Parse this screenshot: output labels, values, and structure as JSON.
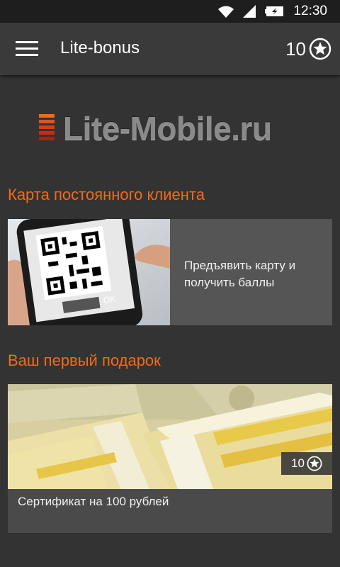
{
  "status_bar": {
    "time": "12:30"
  },
  "app_bar": {
    "title": "Lite-bonus",
    "points": "10"
  },
  "logo": {
    "text": "Lite-Mobile.ru"
  },
  "loyalty_section": {
    "title": "Карта постоянного клиента",
    "card_text": "Предъявить карту и получить баллы",
    "phone_button": "OK"
  },
  "gift_section": {
    "title": "Ваш первый подарок",
    "caption": "Сертификат на 100 рублей",
    "points": "10"
  },
  "colors": {
    "accent": "#f26a1b",
    "background": "#333333",
    "app_bar": "#3a3a3a",
    "card": "#555555"
  }
}
